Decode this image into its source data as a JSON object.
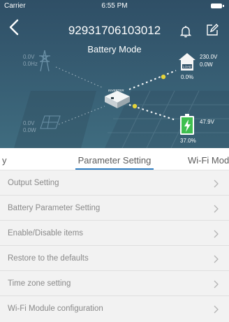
{
  "status_bar": {
    "carrier": "Carrier",
    "time": "6:55 PM"
  },
  "header": {
    "title": "92931706103012",
    "mode": "Battery Mode"
  },
  "icons": {
    "back": "chevron-left-icon",
    "bell": "bell-icon",
    "edit": "edit-icon"
  },
  "diagram": {
    "pv1": {
      "voltage": "0.0V",
      "frequency": "0.0Hz"
    },
    "pv2": {
      "voltage": "0.0V",
      "power": "0.0W"
    },
    "load": {
      "voltage": "230.0V",
      "power": "0.0W",
      "percent": "0.0%",
      "label": "LOAD"
    },
    "battery": {
      "voltage": "47.9V",
      "percent": "37.0%"
    },
    "inverter_label": "INVERTER"
  },
  "tabs": {
    "left_partial": "y",
    "active": "Parameter Setting",
    "right_partial": "Wi-Fi Mod"
  },
  "settings": [
    {
      "label": "Output Setting"
    },
    {
      "label": "Battery Parameter Setting"
    },
    {
      "label": "Enable/Disable items"
    },
    {
      "label": "Restore to the defaults"
    },
    {
      "label": "Time zone setting"
    },
    {
      "label": "Wi-Fi Module configuration"
    }
  ],
  "colors": {
    "hero": "#355a70",
    "accent": "#2e7cc0",
    "flow": "#e6d43a",
    "battery": "#3fbf4f"
  }
}
